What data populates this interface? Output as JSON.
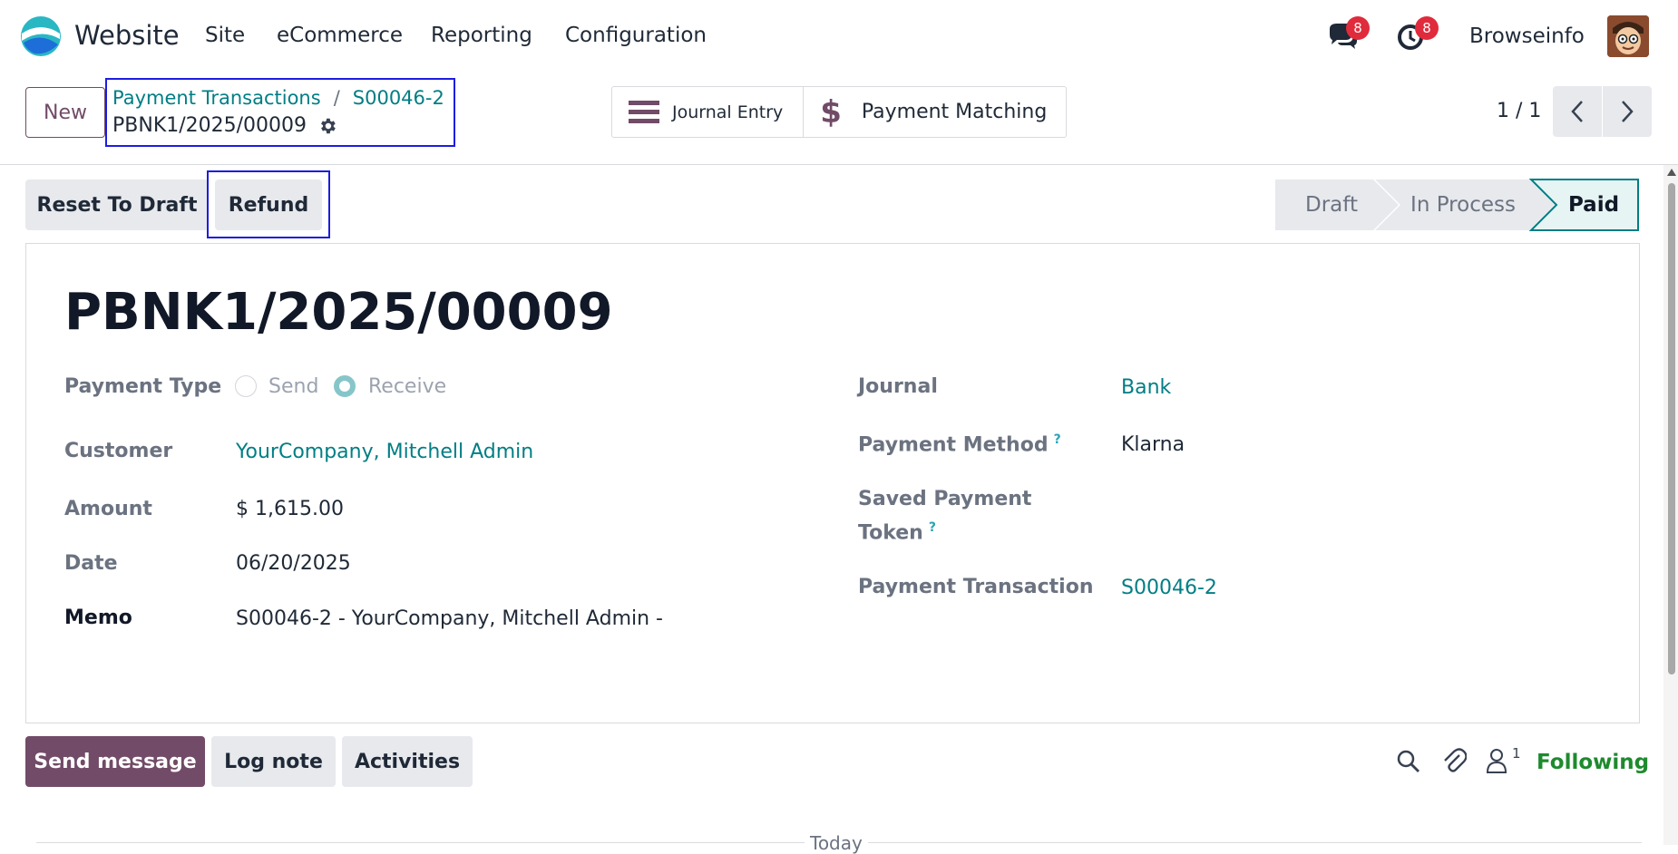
{
  "topbar": {
    "app_name": "Website",
    "menu": [
      "Site",
      "eCommerce",
      "Reporting",
      "Configuration"
    ],
    "messages_count": "8",
    "activities_count": "8",
    "user_name": "Browseinfo"
  },
  "control": {
    "new_label": "New",
    "breadcrumb": [
      "Payment Transactions",
      "S00046-2"
    ],
    "separator": "/",
    "current_record": "PBNK1/2025/00009",
    "smart_buttons": [
      "Journal Entry",
      "Payment Matching"
    ],
    "pager": "1 / 1"
  },
  "status": {
    "reset_label": "Reset To Draft",
    "refund_label": "Refund",
    "stages": [
      "Draft",
      "In Process",
      "Paid"
    ],
    "active_stage": "Paid"
  },
  "form": {
    "title": "PBNK1/2025/00009",
    "payment_type_label": "Payment Type",
    "payment_type_options": [
      "Send",
      "Receive"
    ],
    "payment_type_selected": "Receive",
    "customer_label": "Customer",
    "customer_value": "YourCompany, Mitchell Admin",
    "amount_label": "Amount",
    "amount_value": "$ 1,615.00",
    "date_label": "Date",
    "date_value": "06/20/2025",
    "memo_label": "Memo",
    "memo_value": "S00046-2 - YourCompany, Mitchell Admin -",
    "journal_label": "Journal",
    "journal_value": "Bank",
    "payment_method_label": "Payment Method",
    "payment_method_value": "Klarna",
    "saved_token_label_1": "Saved Payment",
    "saved_token_label_2": "Token",
    "help_mark": "?",
    "transaction_label": "Payment Transaction",
    "transaction_value": "S00046-2"
  },
  "chatter": {
    "send_message_label": "Send message",
    "log_note_label": "Log note",
    "activities_label": "Activities",
    "followers_count": "1",
    "following_label": "Following",
    "today_label": "Today"
  },
  "colors": {
    "brand": "#714B67",
    "link": "#017e84",
    "highlight_box": "#1d1de0",
    "following": "#1e8a2e",
    "badge": "#e02b3c"
  }
}
